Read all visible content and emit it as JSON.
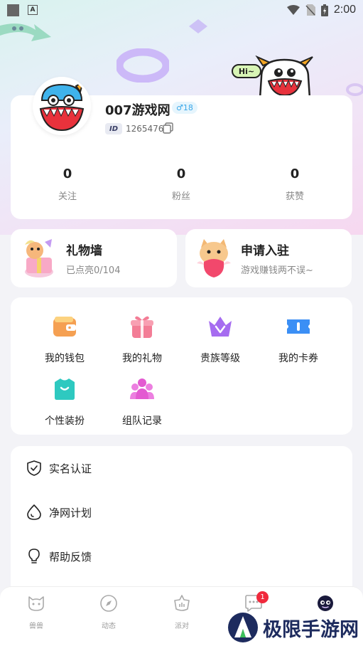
{
  "status_bar": {
    "time": "2:00",
    "a_badge": "A"
  },
  "profile": {
    "username": "007游戏网",
    "gender_badge": "♂18",
    "id_tag": "ID",
    "id_value": "1265476",
    "bubble_text": "Hi~",
    "stats": [
      {
        "value": "0",
        "label": "关注"
      },
      {
        "value": "0",
        "label": "粉丝"
      },
      {
        "value": "0",
        "label": "获赞"
      }
    ]
  },
  "features": [
    {
      "title": "礼物墙",
      "subtitle": "已点亮0/104"
    },
    {
      "title": "申请入驻",
      "subtitle": "游戏赚钱两不误~"
    }
  ],
  "grid": [
    {
      "label": "我的钱包",
      "icon": "wallet-icon",
      "color": "#f5a052"
    },
    {
      "label": "我的礼物",
      "icon": "gift-icon",
      "color": "#f37d96"
    },
    {
      "label": "贵族等级",
      "icon": "crown-icon",
      "color": "#a66cf0"
    },
    {
      "label": "我的卡券",
      "icon": "coupon-icon",
      "color": "#3b8ff5"
    },
    {
      "label": "个性装扮",
      "icon": "shirt-icon",
      "color": "#2ec9c0"
    },
    {
      "label": "组队记录",
      "icon": "team-icon",
      "color": "#e35ad1"
    }
  ],
  "list": [
    {
      "label": "实名认证",
      "icon": "shield-icon"
    },
    {
      "label": "净网计划",
      "icon": "drop-icon"
    },
    {
      "label": "帮助反馈",
      "icon": "bulb-icon"
    }
  ],
  "tabs": [
    {
      "label": "兽兽",
      "icon": "pet-icon"
    },
    {
      "label": "动态",
      "icon": "compass-icon"
    },
    {
      "label": "派对",
      "icon": "party-icon"
    },
    {
      "label": "",
      "icon": "message-icon",
      "badge": "1"
    },
    {
      "label": "",
      "icon": "profile-face-icon"
    }
  ],
  "watermark": "极限手游网"
}
